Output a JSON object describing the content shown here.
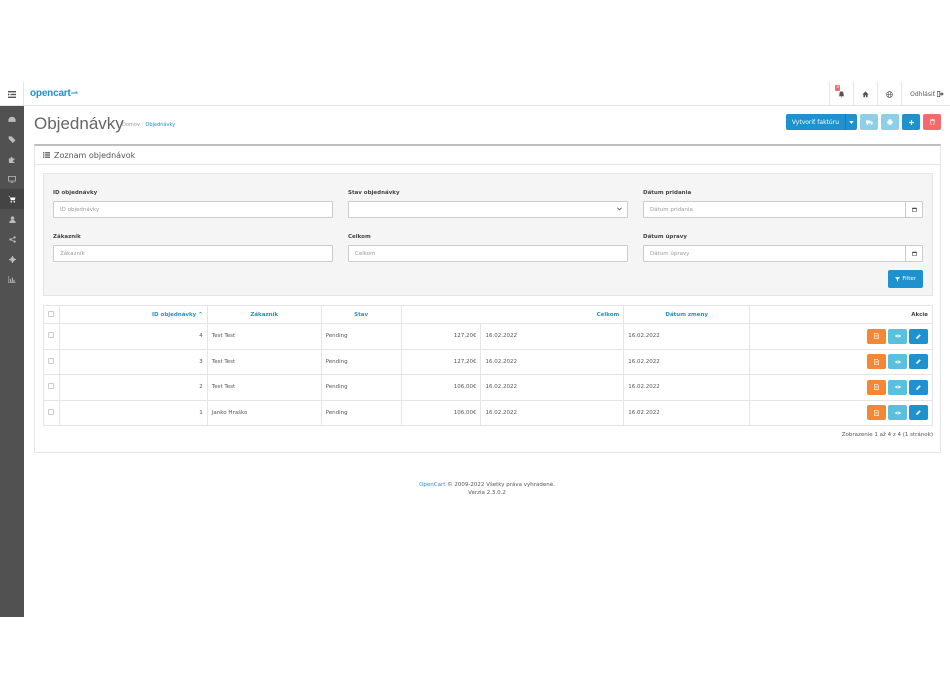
{
  "header": {
    "logo_text": "opencart",
    "logout_label": "Odhlásiť",
    "notifications_count": "3"
  },
  "sidebar": {
    "items": [
      {
        "icon": "dashboard-icon",
        "active": false
      },
      {
        "icon": "tags-icon",
        "active": false
      },
      {
        "icon": "puzzle-icon",
        "active": false
      },
      {
        "icon": "desktop-icon",
        "active": false
      },
      {
        "icon": "shopping-cart-icon",
        "active": true
      },
      {
        "icon": "user-icon",
        "active": false
      },
      {
        "icon": "share-icon",
        "active": false
      },
      {
        "icon": "cog-icon",
        "active": false
      },
      {
        "icon": "bar-chart-icon",
        "active": false
      }
    ]
  },
  "page": {
    "title": "Objednávky",
    "breadcrumb": [
      "Domov",
      "Objednávky"
    ]
  },
  "actions": {
    "invoice_label": "Vytvoriť faktúru"
  },
  "panel": {
    "title": "Zoznam objednávok"
  },
  "filter": {
    "order_id": {
      "label": "ID objednávky",
      "placeholder": "ID objednávky",
      "value": ""
    },
    "status": {
      "label": "Stav objednávky",
      "value": ""
    },
    "date_added": {
      "label": "Dátum pridania",
      "placeholder": "Dátum pridania",
      "value": ""
    },
    "customer": {
      "label": "Zákazník",
      "placeholder": "Zákazník",
      "value": ""
    },
    "total": {
      "label": "Celkom",
      "placeholder": "Celkom",
      "value": ""
    },
    "date_modified": {
      "label": "Dátum úpravy",
      "placeholder": "Dátum úpravy",
      "value": ""
    },
    "button_label": "Filter"
  },
  "table": {
    "columns": [
      "ID objednávky",
      "Zákazník",
      "Stav",
      "Celkom",
      "Dátum pridania",
      "Dátum zmeny",
      "Akcie"
    ],
    "rows": [
      {
        "id": "4",
        "customer": "Test Test",
        "status": "Pending",
        "total": "127,20€",
        "date_added": "16.02.2022",
        "date_modified": "16.02.2022"
      },
      {
        "id": "3",
        "customer": "Test Test",
        "status": "Pending",
        "total": "127,20€",
        "date_added": "16.02.2022",
        "date_modified": "16.02.2022"
      },
      {
        "id": "2",
        "customer": "Test Test",
        "status": "Pending",
        "total": "106,00€",
        "date_added": "16.02.2022",
        "date_modified": "16.02.2022"
      },
      {
        "id": "1",
        "customer": "Janko Hraško",
        "status": "Pending",
        "total": "106,00€",
        "date_added": "16.02.2022",
        "date_modified": "16.02.2022"
      }
    ],
    "pagination_text": "Zobrazenie 1 až 4 z 4 (1 stránok)"
  },
  "footer": {
    "brand": "OpenCart",
    "copyright": " © 2009-2022 Všetky práva vyhradené.",
    "version": "Verzia 2.3.0.2"
  },
  "colors": {
    "primary": "#1e91cf",
    "danger": "#f56b6b",
    "warning": "#f38733",
    "info": "#5bc0de",
    "sidebar": "#515151"
  }
}
